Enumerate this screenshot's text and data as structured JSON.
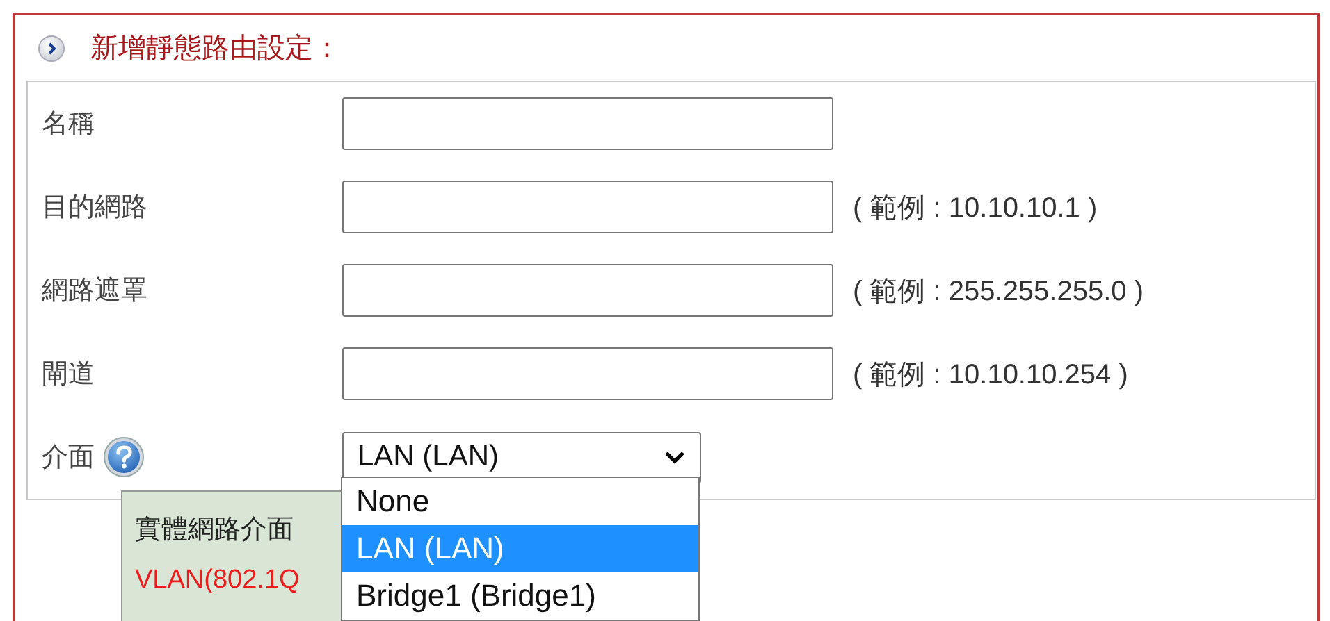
{
  "section": {
    "title": "新增靜態路由設定："
  },
  "fields": [
    {
      "kind": "text",
      "label": "名稱"
    },
    {
      "kind": "text",
      "label": "目的網路",
      "hint": "( 範例 : 10.10.10.1 )"
    },
    {
      "kind": "text",
      "label": "網路遮罩",
      "hint": "( 範例 : 255.255.255.0 )"
    },
    {
      "kind": "text",
      "label": "閘道",
      "hint": "( 範例 : 10.10.10.254 )"
    },
    {
      "kind": "select",
      "label": "介面",
      "value": "LAN (LAN)",
      "help": true
    }
  ],
  "tooltip": {
    "lines": [
      {
        "kind": "plain",
        "text": "實體網路介面"
      },
      {
        "kind": "warning",
        "text": "VLAN(802.1Q"
      }
    ]
  },
  "dropdown": {
    "options": [
      {
        "label": "None",
        "selected": false
      },
      {
        "label": "LAN (LAN)",
        "selected": true
      },
      {
        "label": "Bridge1 (Bridge1)",
        "selected": false
      }
    ]
  }
}
